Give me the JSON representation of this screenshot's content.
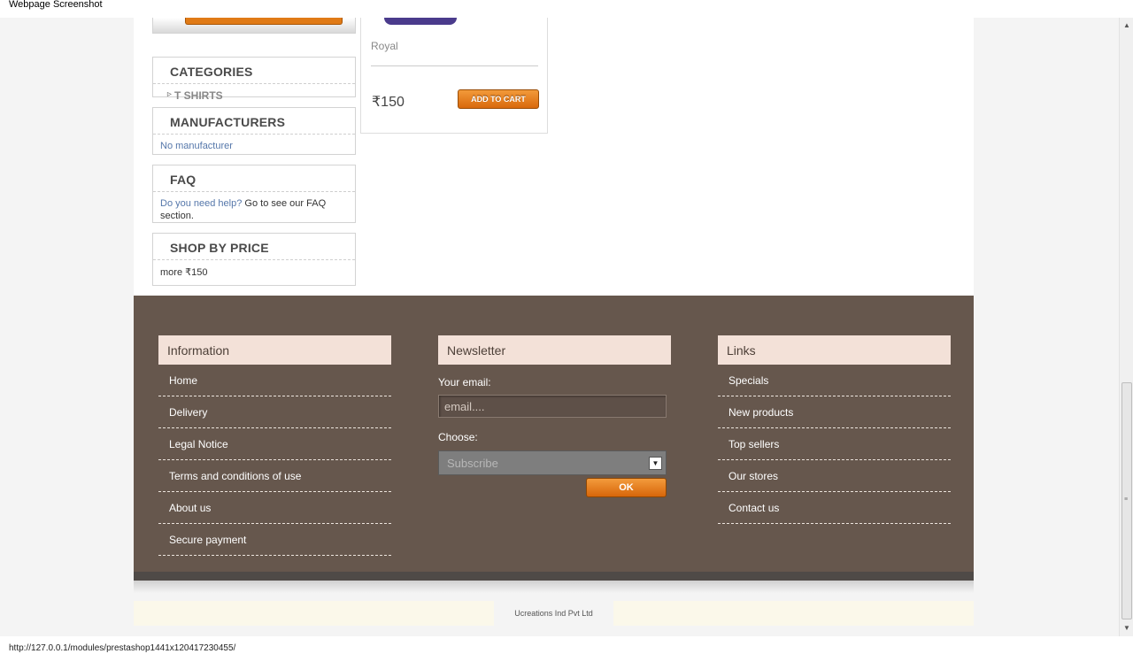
{
  "window": {
    "title": "Webpage Screenshot",
    "status_url": "http://127.0.0.1/modules/prestashop1441x120417230455/"
  },
  "sidebar": {
    "categories": {
      "title": "CATEGORIES",
      "items": [
        "T SHIRTS"
      ]
    },
    "manufacturers": {
      "title": "MANUFACTURERS",
      "empty_text": "No manufacturer"
    },
    "faq": {
      "title": "FAQ",
      "link_text": "Do you need help?",
      "text": " Go to see our FAQ section."
    },
    "shop_by_price": {
      "title": "SHOP BY PRICE",
      "range": "more ₹150"
    }
  },
  "product": {
    "name": "Royal",
    "price": "₹150",
    "add_to_cart_label": "ADD TO CART"
  },
  "footer": {
    "information": {
      "title": "Information",
      "links": [
        "Home",
        "Delivery",
        "Legal Notice",
        "Terms and conditions of use",
        "About us",
        "Secure payment"
      ]
    },
    "newsletter": {
      "title": "Newsletter",
      "email_label": "Your email:",
      "email_placeholder": "email....",
      "choose_label": "Choose:",
      "selected_option": "Subscribe",
      "ok_label": "OK"
    },
    "links": {
      "title": "Links",
      "items": [
        "Specials",
        "New products",
        "Top sellers",
        "Our stores",
        "Contact us"
      ]
    },
    "copyright": "Ucreations Ind Pvt Ltd"
  },
  "colors": {
    "footer_bg": "#66574d",
    "footer_heading_bg": "#f3e1d8",
    "button_orange": "#e07a16",
    "link_blue": "#5577aa"
  }
}
